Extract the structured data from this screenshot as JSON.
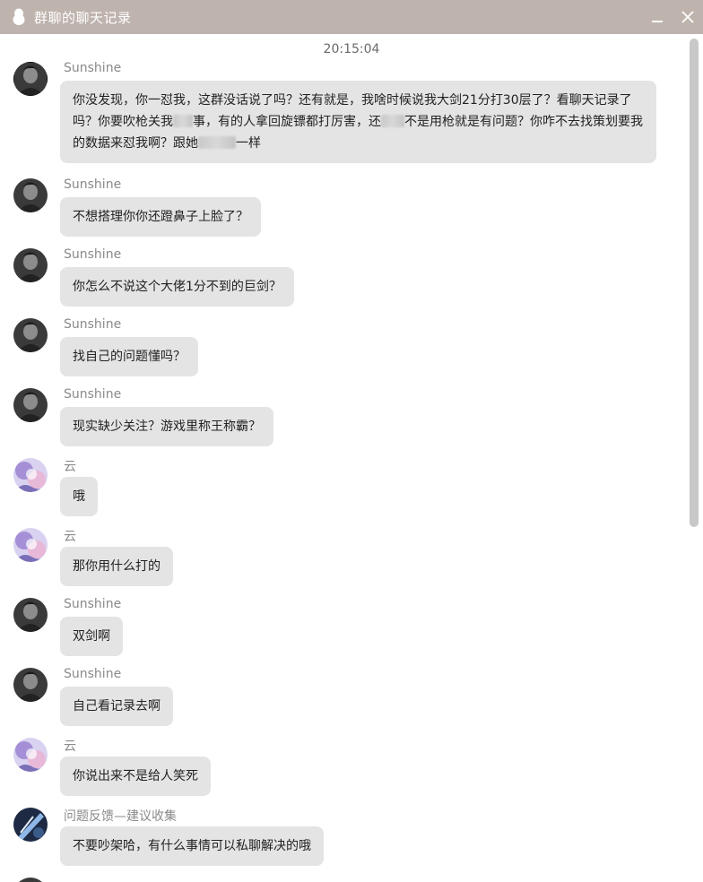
{
  "window": {
    "title": "群聊的聊天记录",
    "icon": "qq-penguin-icon",
    "minimize_icon": "minimize-icon",
    "close_icon": "close-icon"
  },
  "timestamp": "20:15:04",
  "colors": {
    "titlebar": "#bfb3ad",
    "bubble": "#e4e4e4",
    "sender": "#8a8a8a"
  },
  "messages": [
    {
      "sender": "Sunshine",
      "avatar": "sunshine-avatar",
      "parts": [
        "你没发现，你一怼我，这群没话说了吗？还有就是，我啥时候说我大剑21分打30层了？看聊天记录了吗？你要吹枪关我",
        "事，有的人拿回旋镖都打厉害，还",
        "不是用枪就是有问题？你咋不去找策划要我的数据来怼我啊？跟她",
        "一样"
      ]
    },
    {
      "sender": "Sunshine",
      "avatar": "sunshine-avatar",
      "text": "不想搭理你你还蹬鼻子上脸了？"
    },
    {
      "sender": "Sunshine",
      "avatar": "sunshine-avatar",
      "text": "你怎么不说这个大佬1分不到的巨剑？"
    },
    {
      "sender": "Sunshine",
      "avatar": "sunshine-avatar",
      "text": "找自己的问题懂吗？"
    },
    {
      "sender": "Sunshine",
      "avatar": "sunshine-avatar",
      "text": "现实缺少关注？游戏里称王称霸？"
    },
    {
      "sender": "云",
      "avatar": "yun-avatar",
      "text": "哦"
    },
    {
      "sender": "云",
      "avatar": "yun-avatar",
      "text": "那你用什么打的"
    },
    {
      "sender": "Sunshine",
      "avatar": "sunshine-avatar",
      "text": "双剑啊"
    },
    {
      "sender": "Sunshine",
      "avatar": "sunshine-avatar",
      "text": "自己看记录去啊"
    },
    {
      "sender": "云",
      "avatar": "yun-avatar",
      "text": "你说出来不是给人笑死"
    },
    {
      "sender": "问题反馈—建议收集",
      "avatar": "feedback-avatar",
      "text": "不要吵架哈，有什么事情可以私聊解决的哦"
    }
  ]
}
